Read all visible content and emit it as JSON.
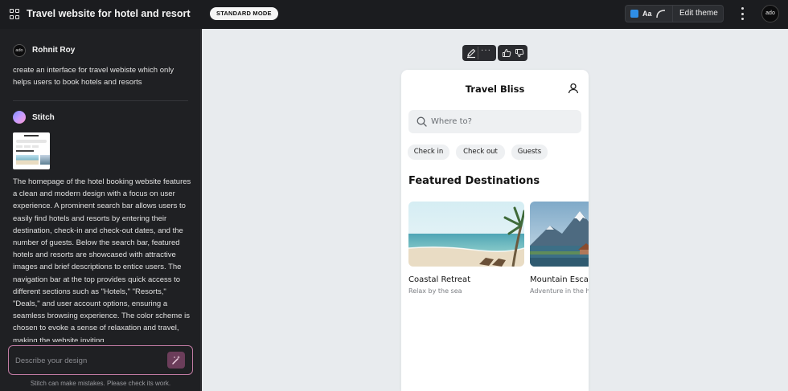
{
  "topbar": {
    "project_title": "Travel website for hotel and resort",
    "mode_badge": "STANDARD MODE",
    "theme_aa": "Aa",
    "edit_theme": "Edit theme",
    "account_avatar": "ado",
    "accent_color": "#2f8ee6"
  },
  "chat": {
    "user": {
      "name": "Rohnit Roy",
      "avatar": "ado",
      "message": "create an interface for travel webiste which only helps users to book hotels and resorts"
    },
    "assistant": {
      "name": "Stitch",
      "description": "The homepage of the hotel booking website features a clean and modern design with a focus on user experience. A prominent search bar allows users to easily find hotels and resorts by entering their destination, check-in and check-out dates, and the number of guests. Below the search bar, featured hotels and resorts are showcased with attractive images and brief descriptions to entice users. The navigation bar at the top provides quick access to different sections such as \"Hotels,\" \"Resorts,\" \"Deals,\" and user account options, ensuring a seamless browsing experience. The color scheme is chosen to evoke a sense of relaxation and travel, making the website inviting"
    },
    "composer_placeholder": "Describe your design",
    "disclaimer": "Stitch can make mistakes. Please check its work."
  },
  "preview": {
    "brand": "Travel Bliss",
    "search_placeholder": "Where to?",
    "chips": [
      "Check in",
      "Check out",
      "Guests"
    ],
    "section_title": "Featured Destinations",
    "cards": [
      {
        "title": "Coastal Retreat",
        "subtitle": "Relax by the sea"
      },
      {
        "title": "Mountain Escape",
        "subtitle": "Adventure in the hills"
      }
    ]
  },
  "icons": {
    "grid": "grid-icon",
    "more_horizontal": "more-horizontal-icon",
    "more_vertical": "more-vertical-icon",
    "pencil": "pencil-icon",
    "thumbs_up": "thumbs-up-icon",
    "thumbs_down": "thumbs-down-icon",
    "search": "search-icon",
    "profile": "user-icon",
    "sparkle_pen": "magic-pen-icon"
  }
}
